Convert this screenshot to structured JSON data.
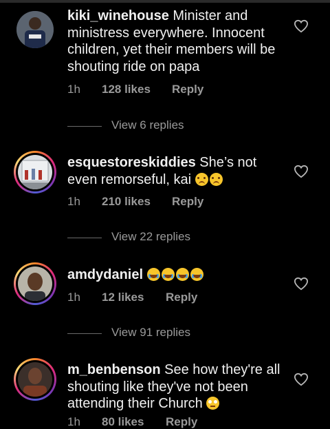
{
  "comments": [
    {
      "username": "kiki_winehouse",
      "text": " Minister and ministress everywhere. Innocent children, yet their members will be shouting ride on papa",
      "time": "1h",
      "likes": "128 likes",
      "reply": "Reply",
      "view_replies": "View 6 replies"
    },
    {
      "username": "esquestoreskiddies",
      "text": " She’s not even remorseful, kai",
      "emojis": [
        "sad",
        "sad"
      ],
      "time": "1h",
      "likes": "210 likes",
      "reply": "Reply",
      "view_replies": "View 22 replies"
    },
    {
      "username": "amdydaniel",
      "emojis": [
        "laugh",
        "laugh",
        "laugh",
        "laugh"
      ],
      "time": "1h",
      "likes": "12 likes",
      "reply": "Reply",
      "view_replies": "View 91 replies"
    },
    {
      "username": "m_benbenson",
      "text": " See how they're all shouting like they've not been attending their Church",
      "emojis": [
        "eyeroll"
      ],
      "time": "1h",
      "likes": "80 likes",
      "reply": "Reply"
    }
  ],
  "icons": {
    "like": "heart-outline-icon"
  },
  "colors": {
    "background": "#000000",
    "muted_text": "#9a9a9a",
    "story_ring": "#dd2a7b"
  }
}
